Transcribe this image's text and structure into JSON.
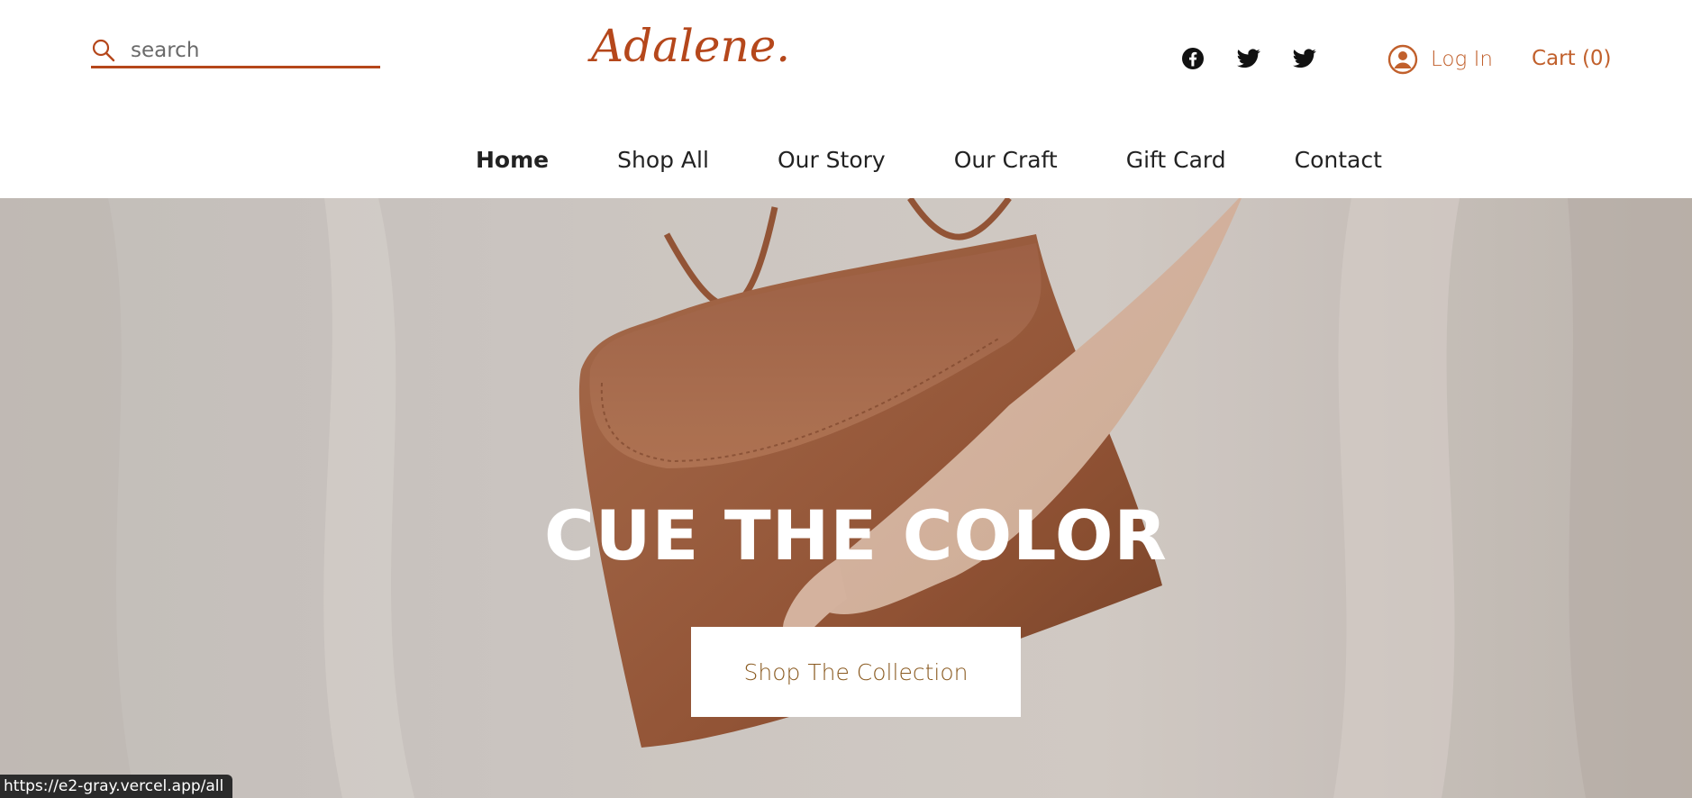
{
  "header": {
    "search": {
      "placeholder": "search",
      "value": ""
    },
    "logo": "Adalene.",
    "social": [
      "facebook-icon",
      "twitter-icon",
      "twitter-icon"
    ],
    "login_label": "Log In",
    "cart_label": "Cart (0)"
  },
  "nav": {
    "items": [
      {
        "label": "Home",
        "active": true
      },
      {
        "label": "Shop All"
      },
      {
        "label": "Our Story"
      },
      {
        "label": "Our Craft"
      },
      {
        "label": "Gift Card"
      },
      {
        "label": "Contact"
      }
    ]
  },
  "hero": {
    "title": "CUE THE COLOR",
    "cta_label": "Shop The Collection"
  },
  "status_bar": {
    "url": "https://e2-gray.vercel.app/all"
  },
  "colors": {
    "accent": "#b5471b",
    "link": "#c1602c",
    "cta_text": "#8a5a20",
    "bag": "#a9643f"
  }
}
